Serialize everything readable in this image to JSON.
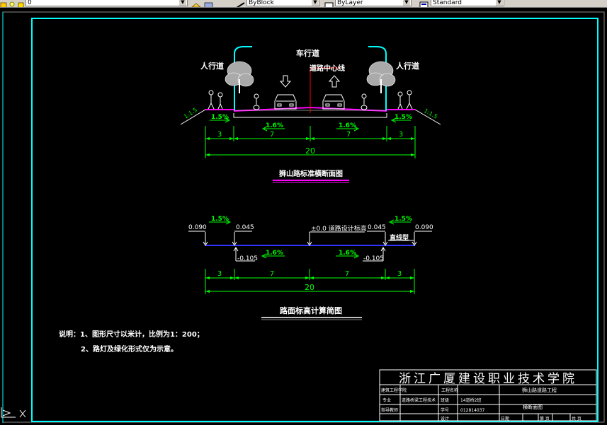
{
  "toolbar": {
    "layer_value": "0",
    "linetype_value": "ByBlock",
    "lineweight_value": "ByLayer",
    "style_value": "Standard"
  },
  "icons": {
    "layer": "layer-icon",
    "linetype": "linetype-icon",
    "lineweight": "lineweight-icon",
    "style": "style-icon",
    "ucs": "ucs-icon"
  },
  "colors": {
    "background": "#000000",
    "frame_cyan": "#00ffff",
    "dim_green": "#00ff00",
    "magenta": "#ff00ff",
    "red": "#ff0000",
    "blue": "#3333ff"
  },
  "section1": {
    "label_sidewalk_left": "人行道",
    "label_sidewalk_right": "人行道",
    "label_carriageway": "车行道",
    "label_centerline": "道路中心线",
    "slope_left": "1:1.5",
    "slope_right": "1:1.5",
    "grade_left": "1.5%",
    "grade_right": "1.5%",
    "grade_mid_left": "1.6%",
    "grade_mid_right": "1.6%",
    "dims": [
      "3",
      "7",
      "7",
      "3"
    ],
    "total": "20",
    "title": "狮山路标准横断面图"
  },
  "section2": {
    "grade_left": "1.5%",
    "grade_right": "1.5%",
    "elev_left_outer": "0.090",
    "elev_left_inner": "0.045",
    "elev_right_inner": "0.045",
    "elev_right_outer": "0.090",
    "design_label": "±0.0 道路设计标高",
    "curve_label": "直线型",
    "low_left": "-0.105",
    "low_right": "-0.105",
    "grade_mid_left": "1.6%",
    "grade_mid_right": "1.6%",
    "dims": [
      "3",
      "7",
      "7",
      "3"
    ],
    "total": "20",
    "title": "路面标高计算简图"
  },
  "notes": {
    "line1": "说明：1、图形尺寸以米计，比例为1：200；",
    "line2": "2、路灯及绿化形式仅为示意。"
  },
  "titleblock": {
    "school": "浙江广厦建设职业技术学院",
    "dept_label": "建筑工程学院",
    "project_label": "工程名称",
    "project_name": "狮山路道路工程",
    "major_label": "专业",
    "major_value": "道路桥梁工程技术",
    "class_label": "班级",
    "class_value": "14道桥2班",
    "drawing_name": "横断面图",
    "instructor_label": "指导教师",
    "student_no_label": "学号",
    "student_no_value": "012814037",
    "designer_label": "设计",
    "date_label": "日期",
    "sheet_label": "第 页",
    "total_label": "共 页"
  }
}
